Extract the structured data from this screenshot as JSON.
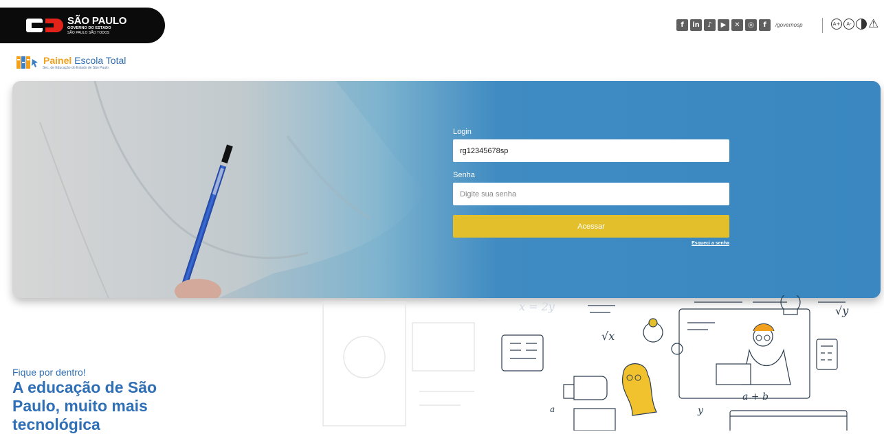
{
  "header": {
    "gov_name": "SÃO PAULO",
    "gov_sub": "GOVERNO DO ESTADO",
    "gov_slogan": "SÃO PAULO SÃO TODOS",
    "social_icons": [
      "flickr-icon",
      "linkedin-icon",
      "tiktok-icon",
      "youtube-icon",
      "x-icon",
      "instagram-icon",
      "facebook-icon"
    ],
    "social_handle": "/governosp",
    "accessibility": {
      "increase_font": "A+",
      "decrease_font": "A-"
    }
  },
  "brand": {
    "title_part1": "Painel",
    "title_part2": "Escola Total",
    "subtitle": "Sec. de Educação do Estado de São Paulo"
  },
  "login": {
    "login_label": "Login",
    "login_value": "rg12345678sp",
    "password_label": "Senha",
    "password_placeholder": "Digite sua senha",
    "submit_label": "Acessar",
    "forgot_label": "Esqueci a senha"
  },
  "promo": {
    "small": "Fique por dentro!",
    "big": "A educação de São Paulo, muito mais tecnológica"
  },
  "colors": {
    "hero_blue": "#3a87c1",
    "button_yellow": "#e3bf2c",
    "brand_blue": "#2f6fb5",
    "brand_orange": "#f2a11e"
  }
}
